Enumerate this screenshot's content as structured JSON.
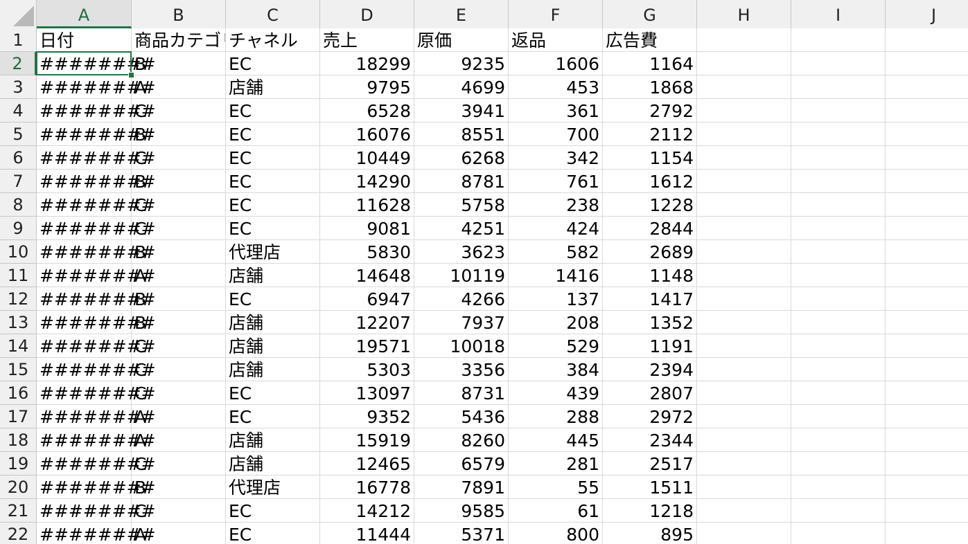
{
  "columns": [
    "A",
    "B",
    "C",
    "D",
    "E",
    "F",
    "G",
    "H",
    "I",
    "J"
  ],
  "active": {
    "column": "A",
    "row": 2
  },
  "colors": {
    "accent": "#217346",
    "header_bg": "#f0f0f0",
    "grid": "#d9d9d9"
  },
  "rows": [
    {
      "n": "1",
      "cells": [
        "日付",
        "商品カテゴリ",
        "チャネル",
        "売上",
        "原価",
        "返品",
        "広告費"
      ]
    },
    {
      "n": "2",
      "cells": [
        "########",
        "B",
        "EC",
        "18299",
        "9235",
        "1606",
        "1164"
      ]
    },
    {
      "n": "3",
      "cells": [
        "########",
        "A",
        "店舗",
        "9795",
        "4699",
        "453",
        "1868"
      ]
    },
    {
      "n": "4",
      "cells": [
        "########",
        "C",
        "EC",
        "6528",
        "3941",
        "361",
        "2792"
      ]
    },
    {
      "n": "5",
      "cells": [
        "########",
        "B",
        "EC",
        "16076",
        "8551",
        "700",
        "2112"
      ]
    },
    {
      "n": "6",
      "cells": [
        "########",
        "C",
        "EC",
        "10449",
        "6268",
        "342",
        "1154"
      ]
    },
    {
      "n": "7",
      "cells": [
        "########",
        "B",
        "EC",
        "14290",
        "8781",
        "761",
        "1612"
      ]
    },
    {
      "n": "8",
      "cells": [
        "########",
        "C",
        "EC",
        "11628",
        "5758",
        "238",
        "1228"
      ]
    },
    {
      "n": "9",
      "cells": [
        "########",
        "C",
        "EC",
        "9081",
        "4251",
        "424",
        "2844"
      ]
    },
    {
      "n": "10",
      "cells": [
        "########",
        "B",
        "代理店",
        "5830",
        "3623",
        "582",
        "2689"
      ]
    },
    {
      "n": "11",
      "cells": [
        "########",
        "A",
        "店舗",
        "14648",
        "10119",
        "1416",
        "1148"
      ]
    },
    {
      "n": "12",
      "cells": [
        "########",
        "B",
        "EC",
        "6947",
        "4266",
        "137",
        "1417"
      ]
    },
    {
      "n": "13",
      "cells": [
        "########",
        "B",
        "店舗",
        "12207",
        "7937",
        "208",
        "1352"
      ]
    },
    {
      "n": "14",
      "cells": [
        "########",
        "C",
        "店舗",
        "19571",
        "10018",
        "529",
        "1191"
      ]
    },
    {
      "n": "15",
      "cells": [
        "########",
        "C",
        "店舗",
        "5303",
        "3356",
        "384",
        "2394"
      ]
    },
    {
      "n": "16",
      "cells": [
        "########",
        "C",
        "EC",
        "13097",
        "8731",
        "439",
        "2807"
      ]
    },
    {
      "n": "17",
      "cells": [
        "########",
        "A",
        "EC",
        "9352",
        "5436",
        "288",
        "2972"
      ]
    },
    {
      "n": "18",
      "cells": [
        "########",
        "A",
        "店舗",
        "15919",
        "8260",
        "445",
        "2344"
      ]
    },
    {
      "n": "19",
      "cells": [
        "########",
        "C",
        "店舗",
        "12465",
        "6579",
        "281",
        "2517"
      ]
    },
    {
      "n": "20",
      "cells": [
        "########",
        "B",
        "代理店",
        "16778",
        "7891",
        "55",
        "1511"
      ]
    },
    {
      "n": "21",
      "cells": [
        "########",
        "C",
        "EC",
        "14212",
        "9585",
        "61",
        "1218"
      ]
    },
    {
      "n": "22",
      "cells": [
        "########",
        "A",
        "EC",
        "11444",
        "5371",
        "800",
        "895"
      ]
    }
  ]
}
